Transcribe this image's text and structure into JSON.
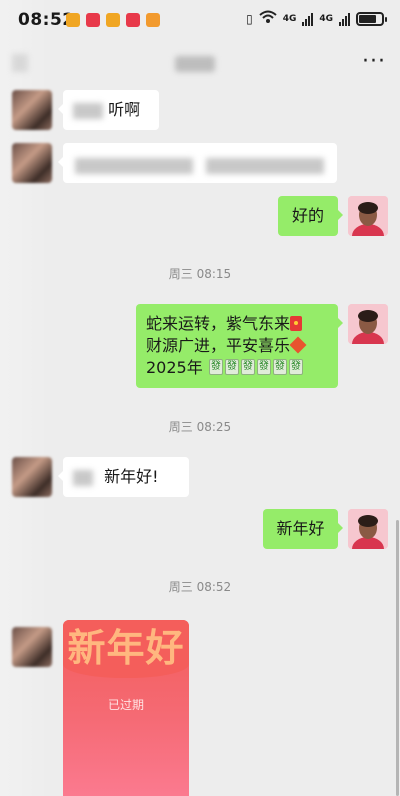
{
  "status_bar": {
    "time": "08:52",
    "notifications": [
      {
        "icon": "shop-app-icon",
        "color": "#f0a623"
      },
      {
        "icon": "shop-app-icon",
        "color": "#e8394a"
      },
      {
        "icon": "shop-app-icon",
        "color": "#f0a623"
      },
      {
        "icon": "shop-app-icon",
        "color": "#e8394a"
      },
      {
        "icon": "video-app-icon",
        "color": "#f29a2e"
      }
    ],
    "network_1": "4G",
    "network_2": "4G"
  },
  "nav": {
    "more_label": "···"
  },
  "chat": {
    "msg1_text": "听啊",
    "msg3_text": "好的",
    "ts1": "周三 08:15",
    "msg4_line1": "蛇来运转，紫气东来",
    "msg4_line2a": "财源广进，平安喜乐",
    "msg4_line3": "2025年",
    "ts2": "周三 08:25",
    "msg5_text": "新年好!",
    "msg6_text": "新年好",
    "ts3": "周三 08:52",
    "red_packet": {
      "greeting": "新年好",
      "status": "已过期"
    }
  },
  "colors": {
    "background": "#ededed",
    "my_bubble": "#95ec69",
    "their_bubble": "#ffffff",
    "red_packet": "#f35d5a"
  }
}
